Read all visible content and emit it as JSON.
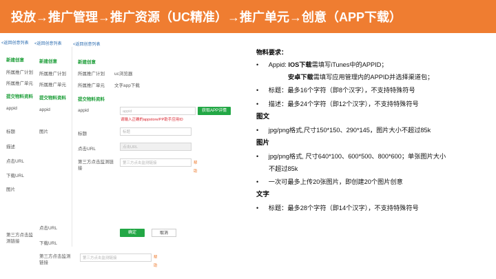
{
  "header": {
    "title": "投放→推广管理→推广资源（UC精准）→推广单元→创意（APP下载）",
    "bg_color": "#ef7d31"
  },
  "screenshot": {
    "back_link": "<返回创意列表",
    "col1": {
      "new_creative": "新建创意",
      "plan_label": "所属推广计划",
      "unit_label": "所属推广单元",
      "submit_material": "提交物料资料",
      "appid": "appid",
      "title": "标题",
      "desc": "描述",
      "click_url": "点击URL",
      "download_url": "下载URL",
      "image": "图片",
      "third_party": "第三方点击监测链接"
    },
    "col2": {
      "new_creative": "新建创意",
      "plan_label": "所属推广计划",
      "unit_label": "所属推广单元",
      "submit_material": "提交物料资料",
      "appid": "appid",
      "image": "图片",
      "click_url": "点击URL",
      "download_url": "下载URL",
      "third_party": "第三方点击监测链接",
      "third_party_placeholder": "第三方点击监测链接",
      "help": "帮助"
    },
    "col3": {
      "new_creative": "新建创意",
      "plan_label": "所属推广计划",
      "plan_value": "uc浏览器",
      "unit_label": "所属推广单元",
      "unit_value": "文字app下载",
      "submit_material": "提交物料资料",
      "appid": "appid",
      "appid_placeholder": "appid",
      "get_app_details": "获取APP详情",
      "appid_error": "请输入正确的appstore/PP助手应用ID",
      "title": "标题",
      "title_placeholder": "标题",
      "click_url": "点击URL",
      "click_url_placeholder": "点击URL",
      "third_party": "第三方点击监测链接",
      "third_party_placeholder": "第三方点击监测链接",
      "help": "帮助",
      "confirm": "确定",
      "cancel": "取消"
    }
  },
  "requirements": {
    "heading": "物料要求：",
    "ios": {
      "prefix": "Appid: ",
      "bold": "IOS下载",
      "rest": "需填写iTunes中的APPID；"
    },
    "android": {
      "bold": "安卓下载",
      "rest": "需填写应用管理内的APPID并选择渠道包；"
    },
    "title_rule": "标题：最多16个字符（即8个汉字），不支持特殊符号",
    "desc_rule": "描述：最多24个字符（即12个汉字），不支持特殊符号",
    "sec_image_text": "图文",
    "image_text_rule": " jpg/png格式,尺寸150*150、290*145，图片大小不超过85k",
    "sec_image": "图片",
    "image_rule_1": "jpg/png格式, 尺寸640*100、600*500、800*600；单张图片大小",
    "image_rule_2": "不超过85k",
    "image_count_rule": "一次可最多上传20张图片，即创建20个图片创意",
    "sec_text": "文字",
    "text_rule": "标题：最多28个字符（即14个汉字），不支持特殊符号",
    "bullet": "•"
  }
}
